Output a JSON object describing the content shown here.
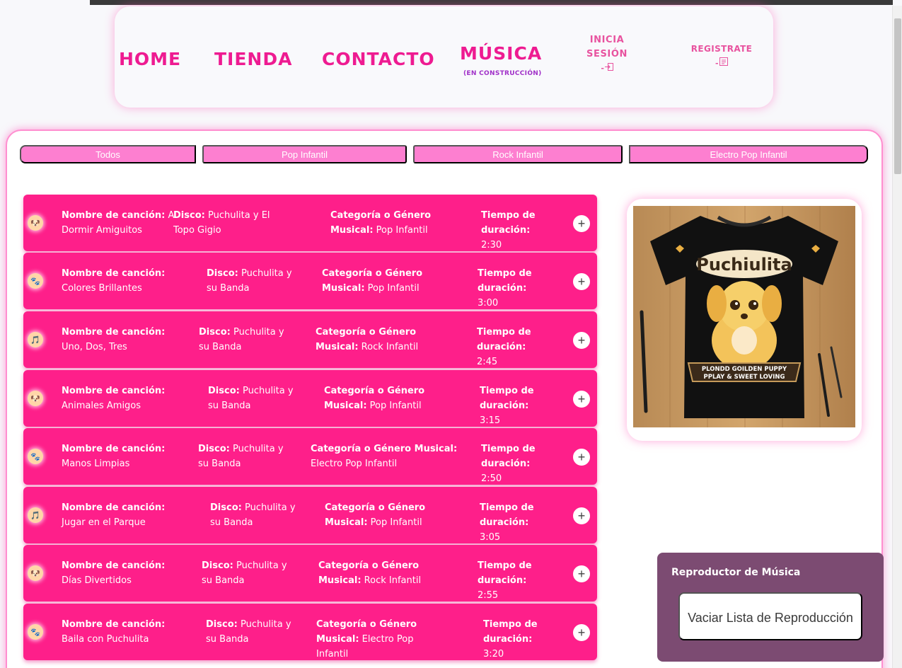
{
  "nav": {
    "home": "HOME",
    "tienda": "TIENDA",
    "contacto": "CONTACTO",
    "musica": "MÚSICA",
    "musica_sub": "(EN CONSTRUCCIÓN)",
    "login_line1": "INICIA",
    "login_line2": "SESIÓN",
    "register": "REGISTRATE"
  },
  "filters": [
    "Todos",
    "Pop Infantil",
    "Rock Infantil",
    "Electro Pop Infantil"
  ],
  "labels": {
    "song": "Nombre de canción:",
    "album": "Disco:",
    "genre": "Categoría o Género Musical:",
    "duration": "Tiempo de duración:"
  },
  "songs": [
    {
      "title": "A Dormir Amiguitos",
      "album": "Puchulita y El Topo Gigio",
      "genre": "Pop Infantil",
      "duration": "2:30"
    },
    {
      "title": "Colores Brillantes",
      "album": "Puchulita y su Banda",
      "genre": "Pop Infantil",
      "duration": "3:00"
    },
    {
      "title": "Uno, Dos, Tres",
      "album": "Puchulita y su Banda",
      "genre": "Rock Infantil",
      "duration": "2:45"
    },
    {
      "title": "Animales Amigos",
      "album": "Puchulita y su Banda",
      "genre": "Pop Infantil",
      "duration": "3:15"
    },
    {
      "title": "Manos Limpias",
      "album": "Puchulita y su Banda",
      "genre": "Electro Pop Infantil",
      "duration": "2:50"
    },
    {
      "title": "Jugar en el Parque",
      "album": "Puchulita y su Banda",
      "genre": "Pop Infantil",
      "duration": "3:05"
    },
    {
      "title": "Días Divertidos",
      "album": "Puchulita y su Banda",
      "genre": "Rock Infantil",
      "duration": "2:55"
    },
    {
      "title": "Baila con Puchulita",
      "album": "Puchulita y su Banda",
      "genre": "Electro Pop Infantil",
      "duration": "3:20"
    }
  ],
  "image": {
    "shirt_text": "Puchiulita",
    "banner_line1": "PLONDD GOILDEN PUPPY",
    "banner_line2": "PPLAY & SWEET LOVING"
  },
  "player": {
    "title": "Reproductor de Música",
    "clear_button": "Vaciar Lista de Reproducción"
  },
  "colors": {
    "accent": "#ee1b91",
    "row": "#fe1f8a",
    "filter": "#fd7fd0",
    "player": "#7c4b72"
  },
  "icons": {
    "login": "login-icon",
    "register": "register-icon",
    "add": "plus-circle-icon"
  }
}
